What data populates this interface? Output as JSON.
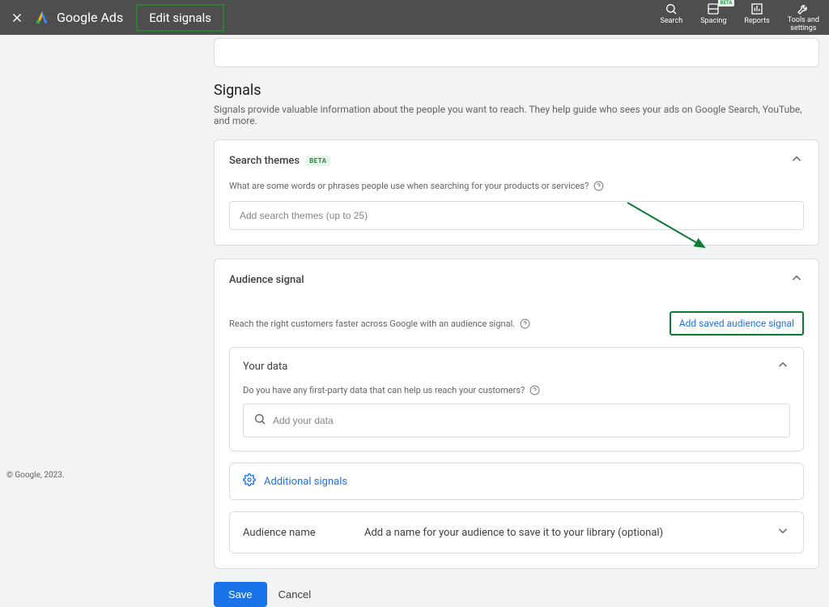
{
  "header": {
    "brand": "Google Ads",
    "page_title": "Edit signals",
    "tools": {
      "search": "Search",
      "spacing": "Spacing",
      "reports": "Reports",
      "tools_settings": "Tools and\nsettings",
      "beta_label": "BETA"
    }
  },
  "signals": {
    "title": "Signals",
    "desc": "Signals provide valuable information about the people you want to reach. They help guide who sees your ads on Google Search, YouTube, and more."
  },
  "search_themes": {
    "title": "Search themes",
    "beta": "BETA",
    "subtext": "What are some words or phrases people use when searching for your products or services?",
    "placeholder": "Add search themes (up to 25)"
  },
  "audience_signal": {
    "title": "Audience signal",
    "desc": "Reach the right customers faster across Google with an audience signal.",
    "add_saved_label": "Add saved audience signal",
    "your_data": {
      "title": "Your data",
      "subtext": "Do you have any first-party data that can help us reach your customers?",
      "placeholder": "Add your data"
    },
    "additional_signals": "Additional signals",
    "audience_name_label": "Audience name",
    "audience_name_hint": "Add a name for your audience to save it to your library (optional)"
  },
  "actions": {
    "save": "Save",
    "cancel": "Cancel"
  },
  "footer": {
    "copyright": "© Google, 2023."
  }
}
